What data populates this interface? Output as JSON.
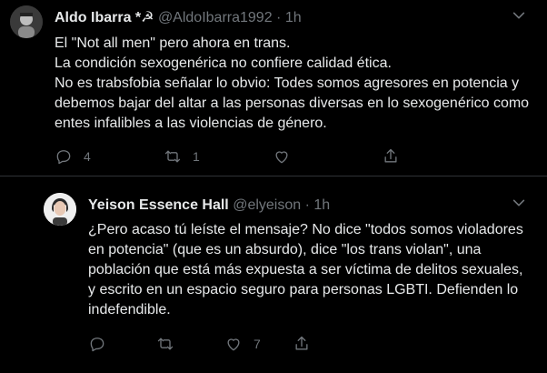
{
  "tweets": [
    {
      "author_name": "Aldo Ibarra *☭",
      "handle": "@AldoIbarra1992",
      "separator": "·",
      "time": "1h",
      "text": "El \"Not all men\" pero ahora en trans.\nLa condición sexogenérica no confiere calidad ética.\nNo es trabsfobia señalar lo obvio: Todes somos agresores en potencia y debemos bajar del altar a las personas diversas en lo sexogenérico como entes infalibles a las violencias de género.",
      "replies": "4",
      "retweets": "1",
      "likes": ""
    },
    {
      "author_name": "Yeison Essence Hall",
      "handle": "@elyeison",
      "separator": "·",
      "time": "1h",
      "text": "¿Pero acaso tú leíste el mensaje? No dice \"todos somos violadores en potencia\" (que es un absurdo), dice \"los trans violan\", una población que está más expuesta a ser víctima de delitos sexuales, y escrito en un espacio seguro para personas LGBTI. Defienden lo indefendible.",
      "replies": "",
      "retweets": "",
      "likes": "7"
    }
  ],
  "icons": {
    "more": "chevron-down-icon",
    "reply": "reply-icon",
    "retweet": "retweet-icon",
    "like": "heart-icon",
    "share": "share-icon"
  },
  "colors": {
    "background": "#000000",
    "text": "#e7e9ea",
    "muted": "#71767b",
    "divider": "#2f3336"
  }
}
